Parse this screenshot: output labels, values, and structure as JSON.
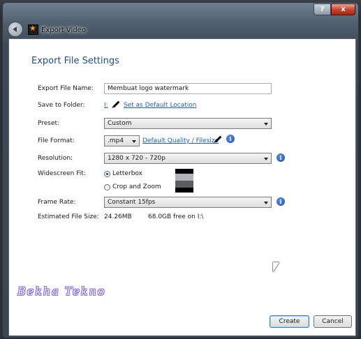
{
  "window": {
    "title": "Export Video",
    "help_glyph": "?",
    "close_glyph": "x"
  },
  "section_title": "Export File Settings",
  "fields": {
    "file_name_label": "Export File Name:",
    "file_name_value": "Membuat logo watermark",
    "folder_label": "Save to Folder:",
    "folder_value": "I:",
    "folder_default_link": "Set as Default Location",
    "preset_label": "Preset:",
    "preset_value": "Custom",
    "format_label": "File Format:",
    "format_value": ".mp4",
    "format_quality_link": "Default Quality / Filesize",
    "resolution_label": "Resolution:",
    "resolution_value": "1280 x 720 - 720p",
    "widescreen_label": "Widescreen Fit:",
    "widescreen_options": [
      "Letterbox",
      "Crop and Zoom"
    ],
    "widescreen_selected": "Letterbox",
    "framerate_label": "Frame Rate:",
    "framerate_value": "Constant 15fps",
    "size_label": "Estimated File Size:",
    "size_value": "24.26MB",
    "free_space": "68.0GB free on I:\\"
  },
  "info_glyph": "i",
  "watermark_text": "Bekha Tekno",
  "buttons": {
    "create": "Create",
    "cancel": "Cancel"
  },
  "icons": [
    "back-arrow-icon",
    "app-star-icon",
    "pencil-icon",
    "info-icon",
    "mouse-cursor-icon"
  ]
}
